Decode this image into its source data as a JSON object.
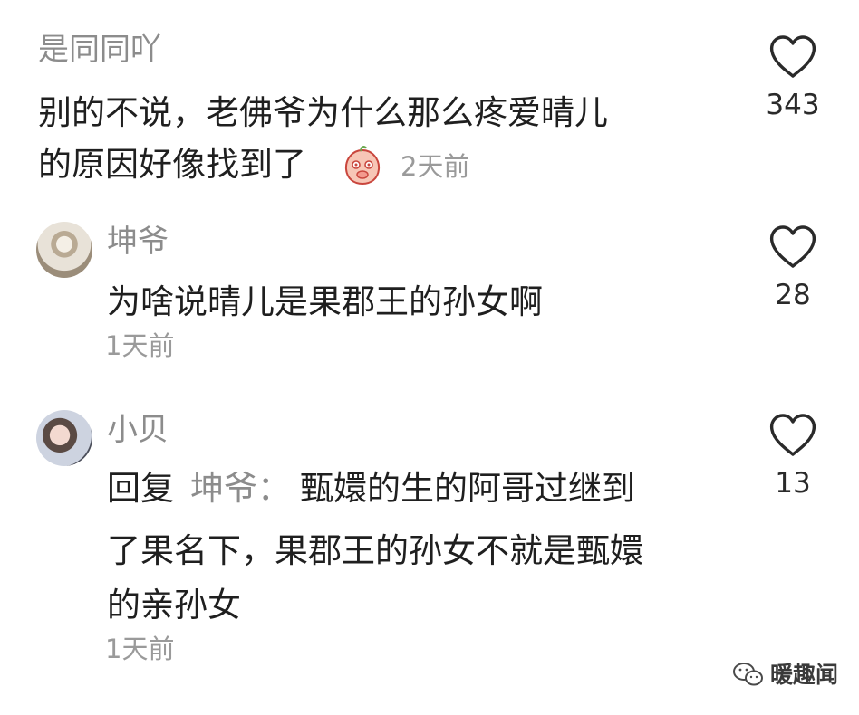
{
  "comment_1": {
    "username": "是同同吖",
    "text_line_1": "别的不说，老佛爷为什么那么疼爱晴儿",
    "text_line_2": "的原因好像找到了",
    "emoji": "peach-face-emoji",
    "time": "2天前",
    "likes": "343"
  },
  "reply_1": {
    "username": "坤爷",
    "text": "为啥说晴儿是果郡王的孙女啊",
    "time": "1天前",
    "likes": "28"
  },
  "reply_2": {
    "username": "小贝",
    "reply_prefix": "回复",
    "reply_to": "坤爷：",
    "text_line_1": "甄嬛的生的阿哥过继到",
    "text_line_2": "了果名下，果郡王的孙女不就是甄嬛",
    "text_line_3": "的亲孙女",
    "time": "1天前",
    "likes": "13"
  },
  "watermark": {
    "label": "暖趣闻",
    "icon": "wechat-icon"
  },
  "colors": {
    "text": "#1f1f1f",
    "muted": "#8c8c8c",
    "icon": "#2a2a2a"
  }
}
